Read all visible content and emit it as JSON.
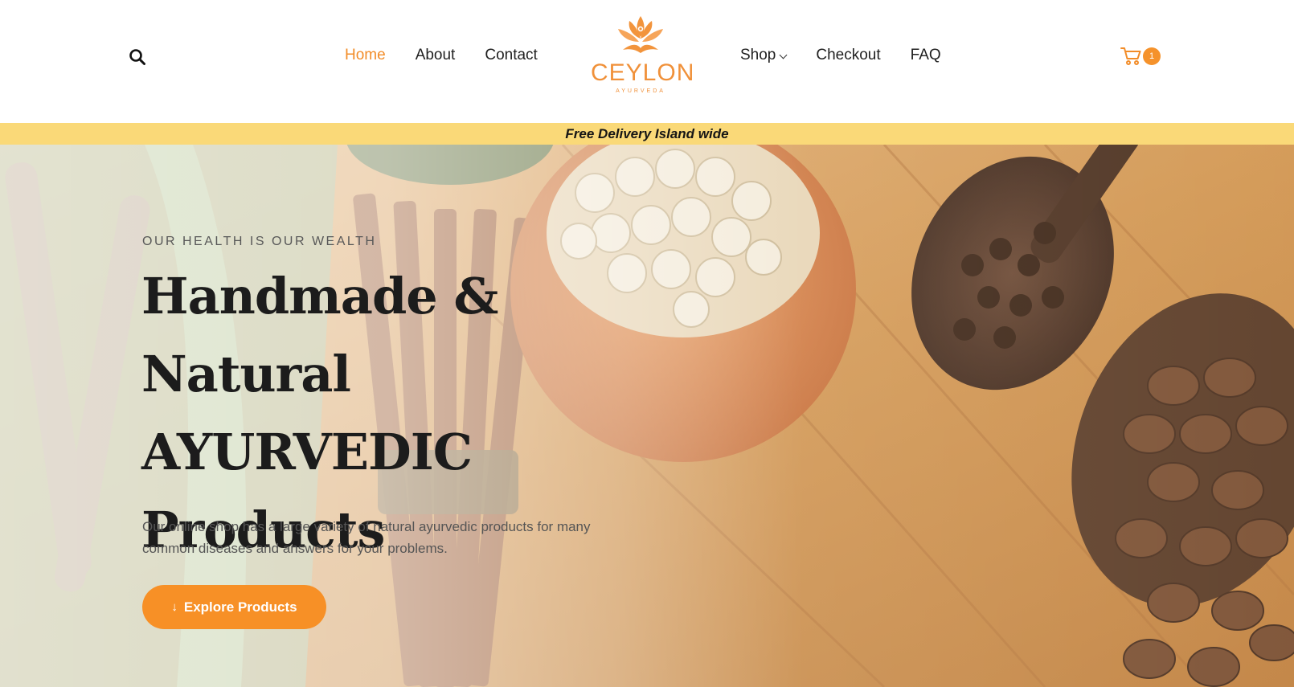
{
  "header": {
    "nav_left": [
      {
        "label": "Home",
        "active": true
      },
      {
        "label": "About"
      },
      {
        "label": "Contact"
      }
    ],
    "nav_right": [
      {
        "label": "Shop",
        "has_dropdown": true
      },
      {
        "label": "Checkout"
      },
      {
        "label": "FAQ"
      }
    ],
    "logo": {
      "name": "CEYLON",
      "tagline": "AYURVEDA"
    },
    "cart": {
      "count": "1"
    },
    "icons": {
      "search": "search-icon",
      "cart": "cart-icon",
      "dropdown": "chevron-down-icon"
    }
  },
  "banner": {
    "text": "Free Delivery Island wide"
  },
  "hero": {
    "eyebrow": "OUR HEALTH IS OUR WEALTH",
    "headline_line1": "Handmade &",
    "headline_line2": "Natural AYURVEDIC",
    "headline_line3": "Products",
    "description": "Our online shop has a large variety of natural ayurvedic products for many common diseases and answers for your problems.",
    "cta_label": "Explore Products"
  },
  "colors": {
    "accent": "#f79026",
    "banner": "#fad978",
    "text": "#1c1c1c"
  }
}
